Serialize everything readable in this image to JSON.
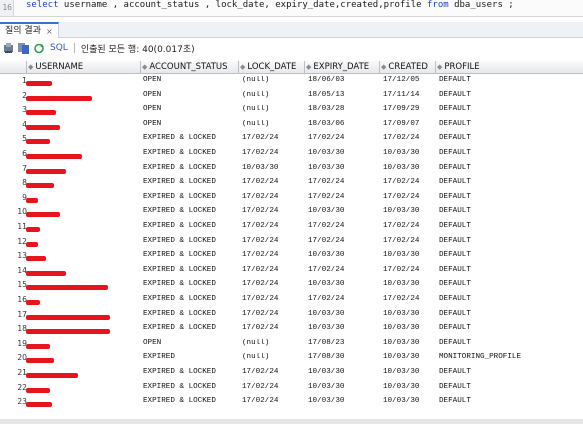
{
  "editor": {
    "line_number": "16",
    "sql": "select username , account_status , lock_date, expiry_date,created,profile from dba_users ;"
  },
  "tab": {
    "label": "질의 결과",
    "close": "×"
  },
  "toolbar": {
    "sql_label": "SQL",
    "status": "인출된 모든 행: 40(0.017초)"
  },
  "columns": [
    "USERNAME",
    "ACCOUNT_STATUS",
    "LOCK_DATE",
    "EXPIRY_DATE",
    "CREATED",
    "PROFILE"
  ],
  "rows": [
    {
      "n": "1",
      "username": "",
      "status": "OPEN",
      "lock": "(null)",
      "expiry": "18/06/03",
      "created": "17/12/05",
      "profile": "DEFAULT"
    },
    {
      "n": "2",
      "username": "",
      "status": "OPEN",
      "lock": "(null)",
      "expiry": "18/05/13",
      "created": "17/11/14",
      "profile": "DEFAULT"
    },
    {
      "n": "3",
      "username": "",
      "status": "OPEN",
      "lock": "(null)",
      "expiry": "18/03/28",
      "created": "17/09/29",
      "profile": "DEFAULT"
    },
    {
      "n": "4",
      "username": "",
      "status": "OPEN",
      "lock": "(null)",
      "expiry": "18/03/06",
      "created": "17/09/07",
      "profile": "DEFAULT"
    },
    {
      "n": "5",
      "username": "",
      "status": "EXPIRED & LOCKED",
      "lock": "17/02/24",
      "expiry": "17/02/24",
      "created": "17/02/24",
      "profile": "DEFAULT"
    },
    {
      "n": "6",
      "username": "",
      "status": "EXPIRED & LOCKED",
      "lock": "17/02/24",
      "expiry": "10/03/30",
      "created": "10/03/30",
      "profile": "DEFAULT"
    },
    {
      "n": "7",
      "username": "",
      "status": "EXPIRED & LOCKED",
      "lock": "10/03/30",
      "expiry": "10/03/30",
      "created": "10/03/30",
      "profile": "DEFAULT"
    },
    {
      "n": "8",
      "username": "",
      "status": "EXPIRED & LOCKED",
      "lock": "17/02/24",
      "expiry": "17/02/24",
      "created": "17/02/24",
      "profile": "DEFAULT"
    },
    {
      "n": "9",
      "username": "",
      "status": "EXPIRED & LOCKED",
      "lock": "17/02/24",
      "expiry": "17/02/24",
      "created": "17/02/24",
      "profile": "DEFAULT"
    },
    {
      "n": "10",
      "username": "",
      "status": "EXPIRED & LOCKED",
      "lock": "17/02/24",
      "expiry": "10/03/30",
      "created": "10/03/30",
      "profile": "DEFAULT"
    },
    {
      "n": "11",
      "username": "",
      "status": "EXPIRED & LOCKED",
      "lock": "17/02/24",
      "expiry": "17/02/24",
      "created": "17/02/24",
      "profile": "DEFAULT"
    },
    {
      "n": "12",
      "username": "",
      "status": "EXPIRED & LOCKED",
      "lock": "17/02/24",
      "expiry": "17/02/24",
      "created": "17/02/24",
      "profile": "DEFAULT"
    },
    {
      "n": "13",
      "username": "",
      "status": "EXPIRED & LOCKED",
      "lock": "17/02/24",
      "expiry": "10/03/30",
      "created": "10/03/30",
      "profile": "DEFAULT"
    },
    {
      "n": "14",
      "username": "",
      "status": "EXPIRED & LOCKED",
      "lock": "17/02/24",
      "expiry": "17/02/24",
      "created": "17/02/24",
      "profile": "DEFAULT"
    },
    {
      "n": "15",
      "username": "",
      "status": "EXPIRED & LOCKED",
      "lock": "17/02/24",
      "expiry": "10/03/30",
      "created": "10/03/30",
      "profile": "DEFAULT"
    },
    {
      "n": "16",
      "username": "",
      "status": "EXPIRED & LOCKED",
      "lock": "17/02/24",
      "expiry": "17/02/24",
      "created": "17/02/24",
      "profile": "DEFAULT"
    },
    {
      "n": "17",
      "username": "",
      "status": "EXPIRED & LOCKED",
      "lock": "17/02/24",
      "expiry": "10/03/30",
      "created": "10/03/30",
      "profile": "DEFAULT"
    },
    {
      "n": "18",
      "username": "",
      "status": "EXPIRED & LOCKED",
      "lock": "17/02/24",
      "expiry": "10/03/30",
      "created": "10/03/30",
      "profile": "DEFAULT"
    },
    {
      "n": "19",
      "username": "",
      "status": "OPEN",
      "lock": "(null)",
      "expiry": "17/08/23",
      "created": "10/03/30",
      "profile": "DEFAULT"
    },
    {
      "n": "20",
      "username": "",
      "status": "EXPIRED",
      "lock": "(null)",
      "expiry": "17/08/30",
      "created": "10/03/30",
      "profile": "MONITORING_PROFILE"
    },
    {
      "n": "21",
      "username": "",
      "status": "EXPIRED & LOCKED",
      "lock": "17/02/24",
      "expiry": "10/03/30",
      "created": "10/03/30",
      "profile": "DEFAULT"
    },
    {
      "n": "22",
      "username": "",
      "status": "EXPIRED & LOCKED",
      "lock": "17/02/24",
      "expiry": "10/03/30",
      "created": "10/03/30",
      "profile": "DEFAULT"
    },
    {
      "n": "23",
      "username": "",
      "status": "EXPIRED & LOCKED",
      "lock": "17/02/24",
      "expiry": "10/03/30",
      "created": "10/03/30",
      "profile": "DEFAULT"
    }
  ],
  "icons": [
    "pin-icon",
    "save-icon",
    "refresh-icon",
    "sql-icon"
  ],
  "colors": {
    "redaction": "#e8141c",
    "sql_keyword": "#1f3fc0",
    "tab_accent": "#3b6fd0"
  }
}
